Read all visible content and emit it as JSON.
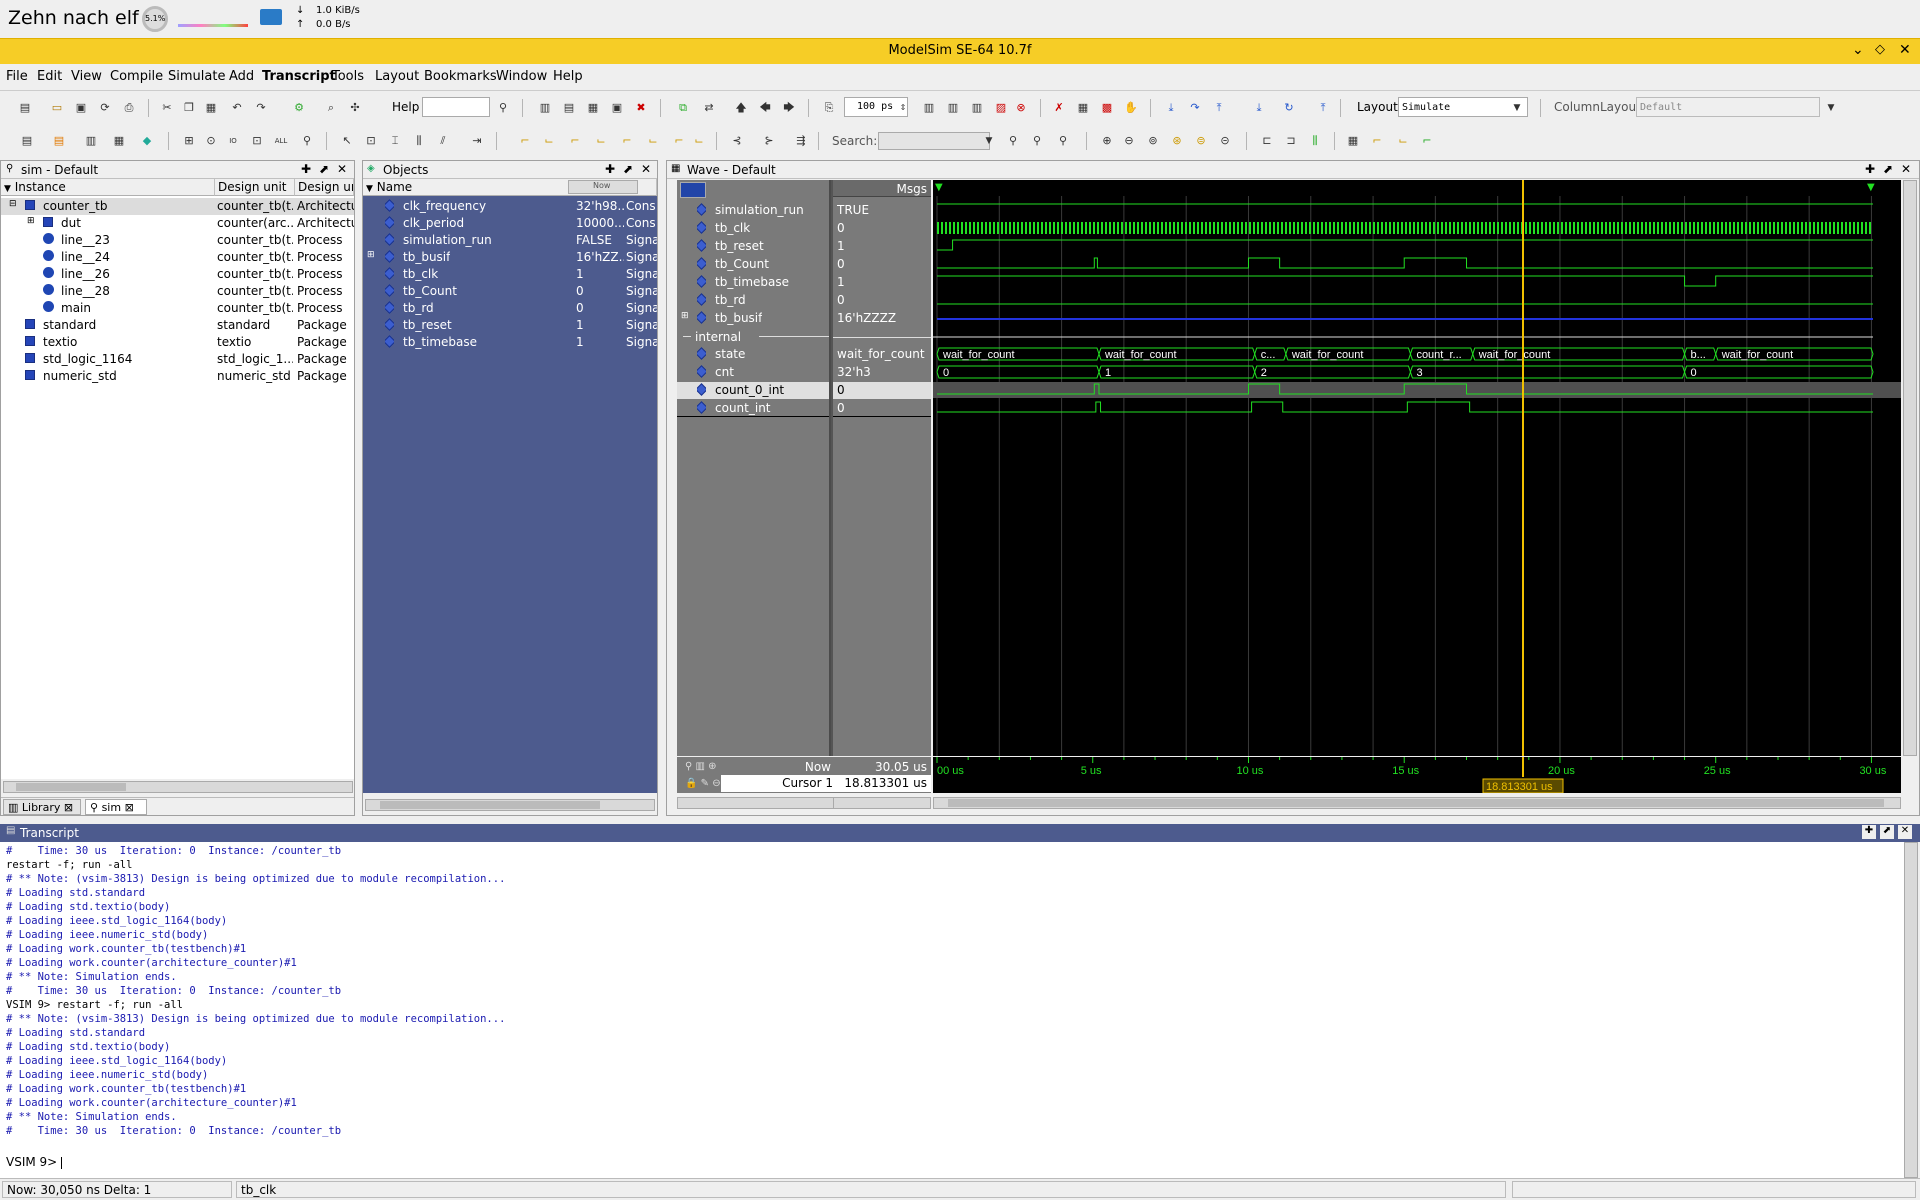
{
  "topbar": {
    "title": "Zehn nach elf",
    "cpu": "5.1%",
    "net_down": "1.0 KiB/s",
    "net_up": "0.0 B/s",
    "down_arrow": "↓",
    "up_arrow": "↑"
  },
  "window": {
    "title": "ModelSim SE-64 10.7f"
  },
  "menu": [
    "File",
    "Edit",
    "View",
    "Compile",
    "Simulate",
    "Add",
    "Transcript",
    "Tools",
    "Layout",
    "Bookmarks",
    "Window",
    "Help"
  ],
  "toolbar": {
    "help_label": "Help",
    "time_value": "100 ps",
    "layout_label": "Layout",
    "layout_value": "Simulate",
    "column_layout_label": "ColumnLayout",
    "column_layout_value": "Default",
    "search_label": "Search:"
  },
  "sim": {
    "title": "sim - Default",
    "headers": [
      "Instance",
      "Design unit",
      "Design un"
    ],
    "rows": [
      {
        "name": "counter_tb",
        "unit": "counter_tb(t...",
        "type": "Architectu"
      },
      {
        "name": "dut",
        "unit": "counter(arc...",
        "type": "Architectu"
      },
      {
        "name": "line__23",
        "unit": "counter_tb(t...",
        "type": "Process"
      },
      {
        "name": "line__24",
        "unit": "counter_tb(t...",
        "type": "Process"
      },
      {
        "name": "line__26",
        "unit": "counter_tb(t...",
        "type": "Process"
      },
      {
        "name": "line__28",
        "unit": "counter_tb(t...",
        "type": "Process"
      },
      {
        "name": "main",
        "unit": "counter_tb(t...",
        "type": "Process"
      },
      {
        "name": "standard",
        "unit": "standard",
        "type": "Package"
      },
      {
        "name": "textio",
        "unit": "textio",
        "type": "Package"
      },
      {
        "name": "std_logic_1164",
        "unit": "std_logic_1...",
        "type": "Package"
      },
      {
        "name": "numeric_std",
        "unit": "numeric_std",
        "type": "Package"
      }
    ],
    "tabs": [
      "Library",
      "sim"
    ]
  },
  "objects": {
    "title": "Objects",
    "header": "Name",
    "now_label": "Now",
    "rows": [
      {
        "name": "clk_frequency",
        "value": "32'h98...",
        "kind": "Cons"
      },
      {
        "name": "clk_period",
        "value": "10000...",
        "kind": "Cons"
      },
      {
        "name": "simulation_run",
        "value": "FALSE",
        "kind": "Signa"
      },
      {
        "name": "tb_busif",
        "value": "16'hZZ...",
        "kind": "Signa"
      },
      {
        "name": "tb_clk",
        "value": "1",
        "kind": "Signa"
      },
      {
        "name": "tb_Count",
        "value": "0",
        "kind": "Signa"
      },
      {
        "name": "tb_rd",
        "value": "0",
        "kind": "Signa"
      },
      {
        "name": "tb_reset",
        "value": "1",
        "kind": "Signa"
      },
      {
        "name": "tb_timebase",
        "value": "1",
        "kind": "Signa"
      }
    ]
  },
  "wave": {
    "title": "Wave - Default",
    "msgs": "Msgs",
    "signals": [
      {
        "name": "simulation_run",
        "value": "TRUE"
      },
      {
        "name": "tb_clk",
        "value": "0"
      },
      {
        "name": "tb_reset",
        "value": "1"
      },
      {
        "name": "tb_Count",
        "value": "0"
      },
      {
        "name": "tb_timebase",
        "value": "1"
      },
      {
        "name": "tb_rd",
        "value": "0"
      },
      {
        "name": "tb_busif",
        "value": "16'hZZZZ"
      }
    ],
    "group": "internal",
    "internal": [
      {
        "name": "state",
        "value": "wait_for_count"
      },
      {
        "name": "cnt",
        "value": "32'h3"
      },
      {
        "name": "count_0_int",
        "value": "0"
      },
      {
        "name": "count_int",
        "value": "0"
      }
    ],
    "state_labels": [
      "wait_for_count",
      "wait_for_count",
      "c...",
      "wait_for_count",
      "count_r...",
      "wait_for_count",
      "b...",
      "wait_for_count"
    ],
    "cnt_labels": [
      "0",
      "1",
      "2",
      "3",
      "0"
    ],
    "now_label": "Now",
    "now_value": "30.05 us",
    "cursor_label": "Cursor 1",
    "cursor_value": "18.813301 us",
    "cursor_time": 18.813301,
    "axis": [
      "00 us",
      "5 us",
      "10 us",
      "15 us",
      "20 us",
      "25 us",
      "30 us"
    ],
    "time_range": [
      0,
      30.05
    ]
  },
  "transcript": {
    "title": "Transcript",
    "lines": [
      "#    Time: 30 us  Iteration: 0  Instance: /counter_tb",
      "restart -f; run -all",
      "# ** Note: (vsim-3813) Design is being optimized due to module recompilation...",
      "# Loading std.standard",
      "# Loading std.textio(body)",
      "# Loading ieee.std_logic_1164(body)",
      "# Loading ieee.numeric_std(body)",
      "# Loading work.counter_tb(testbench)#1",
      "# Loading work.counter(architecture_counter)#1",
      "# ** Note: Simulation ends.",
      "#    Time: 30 us  Iteration: 0  Instance: /counter_tb",
      "VSIM 9> restart -f; run -all",
      "# ** Note: (vsim-3813) Design is being optimized due to module recompilation...",
      "# Loading std.standard",
      "# Loading std.textio(body)",
      "# Loading ieee.std_logic_1164(body)",
      "# Loading ieee.numeric_std(body)",
      "# Loading work.counter_tb(testbench)#1",
      "# Loading work.counter(architecture_counter)#1",
      "# ** Note: Simulation ends.",
      "#    Time: 30 us  Iteration: 0  Instance: /counter_tb"
    ],
    "prompt": "VSIM 9>"
  },
  "status": {
    "now": "Now: 30,050 ns  Delta: 1",
    "signal": "tb_clk"
  },
  "colors": {
    "title_yellow": "#f6cd26",
    "wave_green": "#22e022",
    "selection_blue": "#4d5b8e",
    "cursor_yellow": "#f0c000"
  }
}
